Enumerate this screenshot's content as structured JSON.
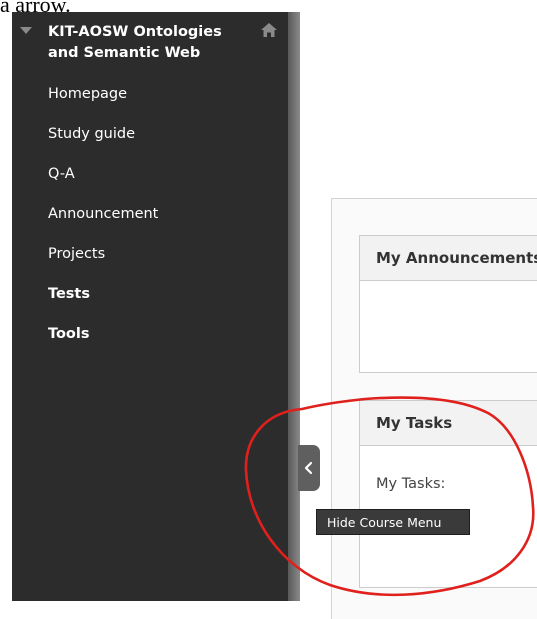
{
  "top_fragment": "a arrow.",
  "course": {
    "title": "KIT-AOSW Ontologies and Semantic Web"
  },
  "menu": {
    "items": [
      {
        "label": "Homepage",
        "bold": false
      },
      {
        "label": "Study guide",
        "bold": false
      },
      {
        "label": "Q-A",
        "bold": false
      },
      {
        "label": "Announcement",
        "bold": false
      },
      {
        "label": "Projects",
        "bold": false
      },
      {
        "label": "Tests",
        "bold": true
      },
      {
        "label": "Tools",
        "bold": true
      }
    ]
  },
  "toggle": {
    "tooltip": "Hide Course Menu"
  },
  "modules": {
    "announcements": {
      "title": "My Announcements"
    },
    "tasks": {
      "title": "My Tasks",
      "body": "My Tasks:"
    }
  },
  "colors": {
    "sidebar_bg": "#2c2c2c",
    "annotation": "#e0201c"
  },
  "icons": {
    "collapse": "triangle-down-icon",
    "home": "home-icon",
    "toggle": "chevron-left-icon"
  }
}
